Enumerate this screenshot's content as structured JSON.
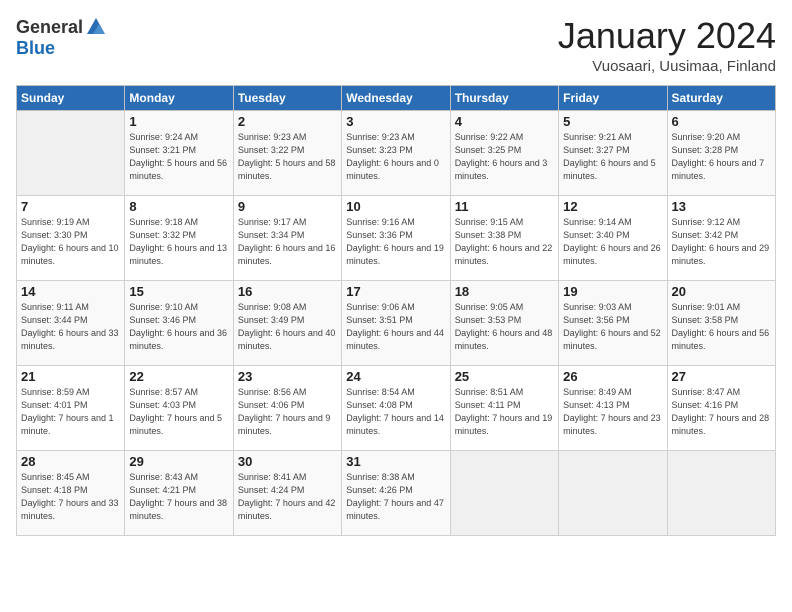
{
  "logo": {
    "general": "General",
    "blue": "Blue"
  },
  "header": {
    "title": "January 2024",
    "subtitle": "Vuosaari, Uusimaa, Finland"
  },
  "weekdays": [
    "Sunday",
    "Monday",
    "Tuesday",
    "Wednesday",
    "Thursday",
    "Friday",
    "Saturday"
  ],
  "weeks": [
    [
      {
        "day": "",
        "sunrise": "",
        "sunset": "",
        "daylight": ""
      },
      {
        "day": "1",
        "sunrise": "Sunrise: 9:24 AM",
        "sunset": "Sunset: 3:21 PM",
        "daylight": "Daylight: 5 hours and 56 minutes."
      },
      {
        "day": "2",
        "sunrise": "Sunrise: 9:23 AM",
        "sunset": "Sunset: 3:22 PM",
        "daylight": "Daylight: 5 hours and 58 minutes."
      },
      {
        "day": "3",
        "sunrise": "Sunrise: 9:23 AM",
        "sunset": "Sunset: 3:23 PM",
        "daylight": "Daylight: 6 hours and 0 minutes."
      },
      {
        "day": "4",
        "sunrise": "Sunrise: 9:22 AM",
        "sunset": "Sunset: 3:25 PM",
        "daylight": "Daylight: 6 hours and 3 minutes."
      },
      {
        "day": "5",
        "sunrise": "Sunrise: 9:21 AM",
        "sunset": "Sunset: 3:27 PM",
        "daylight": "Daylight: 6 hours and 5 minutes."
      },
      {
        "day": "6",
        "sunrise": "Sunrise: 9:20 AM",
        "sunset": "Sunset: 3:28 PM",
        "daylight": "Daylight: 6 hours and 7 minutes."
      }
    ],
    [
      {
        "day": "7",
        "sunrise": "Sunrise: 9:19 AM",
        "sunset": "Sunset: 3:30 PM",
        "daylight": "Daylight: 6 hours and 10 minutes."
      },
      {
        "day": "8",
        "sunrise": "Sunrise: 9:18 AM",
        "sunset": "Sunset: 3:32 PM",
        "daylight": "Daylight: 6 hours and 13 minutes."
      },
      {
        "day": "9",
        "sunrise": "Sunrise: 9:17 AM",
        "sunset": "Sunset: 3:34 PM",
        "daylight": "Daylight: 6 hours and 16 minutes."
      },
      {
        "day": "10",
        "sunrise": "Sunrise: 9:16 AM",
        "sunset": "Sunset: 3:36 PM",
        "daylight": "Daylight: 6 hours and 19 minutes."
      },
      {
        "day": "11",
        "sunrise": "Sunrise: 9:15 AM",
        "sunset": "Sunset: 3:38 PM",
        "daylight": "Daylight: 6 hours and 22 minutes."
      },
      {
        "day": "12",
        "sunrise": "Sunrise: 9:14 AM",
        "sunset": "Sunset: 3:40 PM",
        "daylight": "Daylight: 6 hours and 26 minutes."
      },
      {
        "day": "13",
        "sunrise": "Sunrise: 9:12 AM",
        "sunset": "Sunset: 3:42 PM",
        "daylight": "Daylight: 6 hours and 29 minutes."
      }
    ],
    [
      {
        "day": "14",
        "sunrise": "Sunrise: 9:11 AM",
        "sunset": "Sunset: 3:44 PM",
        "daylight": "Daylight: 6 hours and 33 minutes."
      },
      {
        "day": "15",
        "sunrise": "Sunrise: 9:10 AM",
        "sunset": "Sunset: 3:46 PM",
        "daylight": "Daylight: 6 hours and 36 minutes."
      },
      {
        "day": "16",
        "sunrise": "Sunrise: 9:08 AM",
        "sunset": "Sunset: 3:49 PM",
        "daylight": "Daylight: 6 hours and 40 minutes."
      },
      {
        "day": "17",
        "sunrise": "Sunrise: 9:06 AM",
        "sunset": "Sunset: 3:51 PM",
        "daylight": "Daylight: 6 hours and 44 minutes."
      },
      {
        "day": "18",
        "sunrise": "Sunrise: 9:05 AM",
        "sunset": "Sunset: 3:53 PM",
        "daylight": "Daylight: 6 hours and 48 minutes."
      },
      {
        "day": "19",
        "sunrise": "Sunrise: 9:03 AM",
        "sunset": "Sunset: 3:56 PM",
        "daylight": "Daylight: 6 hours and 52 minutes."
      },
      {
        "day": "20",
        "sunrise": "Sunrise: 9:01 AM",
        "sunset": "Sunset: 3:58 PM",
        "daylight": "Daylight: 6 hours and 56 minutes."
      }
    ],
    [
      {
        "day": "21",
        "sunrise": "Sunrise: 8:59 AM",
        "sunset": "Sunset: 4:01 PM",
        "daylight": "Daylight: 7 hours and 1 minute."
      },
      {
        "day": "22",
        "sunrise": "Sunrise: 8:57 AM",
        "sunset": "Sunset: 4:03 PM",
        "daylight": "Daylight: 7 hours and 5 minutes."
      },
      {
        "day": "23",
        "sunrise": "Sunrise: 8:56 AM",
        "sunset": "Sunset: 4:06 PM",
        "daylight": "Daylight: 7 hours and 9 minutes."
      },
      {
        "day": "24",
        "sunrise": "Sunrise: 8:54 AM",
        "sunset": "Sunset: 4:08 PM",
        "daylight": "Daylight: 7 hours and 14 minutes."
      },
      {
        "day": "25",
        "sunrise": "Sunrise: 8:51 AM",
        "sunset": "Sunset: 4:11 PM",
        "daylight": "Daylight: 7 hours and 19 minutes."
      },
      {
        "day": "26",
        "sunrise": "Sunrise: 8:49 AM",
        "sunset": "Sunset: 4:13 PM",
        "daylight": "Daylight: 7 hours and 23 minutes."
      },
      {
        "day": "27",
        "sunrise": "Sunrise: 8:47 AM",
        "sunset": "Sunset: 4:16 PM",
        "daylight": "Daylight: 7 hours and 28 minutes."
      }
    ],
    [
      {
        "day": "28",
        "sunrise": "Sunrise: 8:45 AM",
        "sunset": "Sunset: 4:18 PM",
        "daylight": "Daylight: 7 hours and 33 minutes."
      },
      {
        "day": "29",
        "sunrise": "Sunrise: 8:43 AM",
        "sunset": "Sunset: 4:21 PM",
        "daylight": "Daylight: 7 hours and 38 minutes."
      },
      {
        "day": "30",
        "sunrise": "Sunrise: 8:41 AM",
        "sunset": "Sunset: 4:24 PM",
        "daylight": "Daylight: 7 hours and 42 minutes."
      },
      {
        "day": "31",
        "sunrise": "Sunrise: 8:38 AM",
        "sunset": "Sunset: 4:26 PM",
        "daylight": "Daylight: 7 hours and 47 minutes."
      },
      {
        "day": "",
        "sunrise": "",
        "sunset": "",
        "daylight": ""
      },
      {
        "day": "",
        "sunrise": "",
        "sunset": "",
        "daylight": ""
      },
      {
        "day": "",
        "sunrise": "",
        "sunset": "",
        "daylight": ""
      }
    ]
  ]
}
